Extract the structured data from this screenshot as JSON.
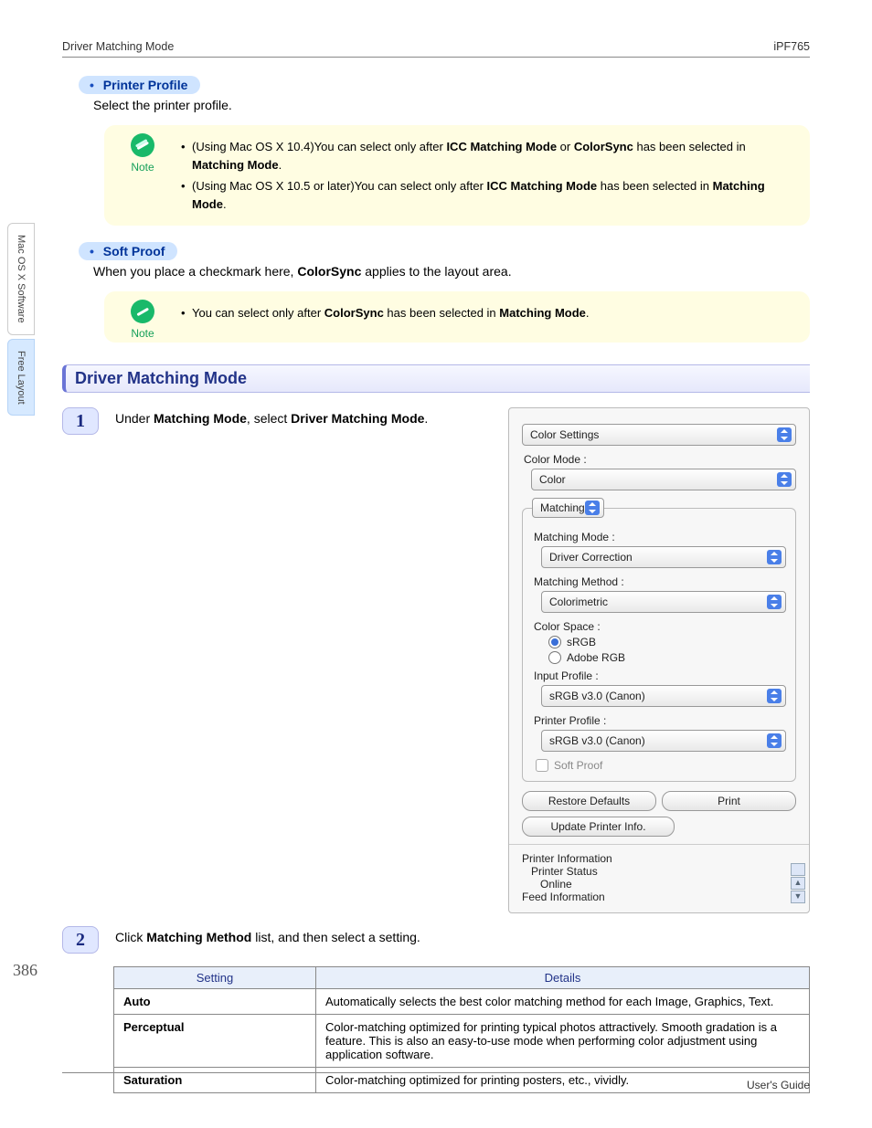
{
  "header": {
    "left": "Driver Matching Mode",
    "right": "iPF765"
  },
  "footer": {
    "text": "User's Guide"
  },
  "page_number": "386",
  "side_tabs": {
    "main": "Mac OS X Software",
    "sub": "Free Layout"
  },
  "sections": {
    "printer_profile": {
      "title": "Printer Profile",
      "desc": "Select the printer profile.",
      "note_label": "Note",
      "notes": [
        {
          "pre": "(Using Mac OS X 10.4)You can select only after ",
          "b1": "ICC Matching Mode",
          "mid1": " or ",
          "b2": "ColorSync",
          "mid2": " has been selected in ",
          "b3": "Matching Mode",
          "post": "."
        },
        {
          "pre": "(Using Mac OS X 10.5 or later)You can select only after ",
          "b1": "ICC Matching Mode",
          "mid1": " has been selected in ",
          "b2": "Matching Mode",
          "post": "."
        }
      ]
    },
    "soft_proof": {
      "title": "Soft Proof",
      "desc_pre": "When you place a checkmark here, ",
      "desc_b": "ColorSync",
      "desc_post": " applies to the layout area.",
      "note_label": "Note",
      "notes": [
        {
          "pre": "You can select only after ",
          "b1": "ColorSync",
          "mid1": " has been selected in ",
          "b2": "Matching Mode",
          "post": "."
        }
      ]
    }
  },
  "main_heading": "Driver Matching Mode",
  "steps": {
    "s1": {
      "num": "1",
      "pre": "Under ",
      "b1": "Matching Mode",
      "mid": ", select ",
      "b2": "Driver Matching Mode",
      "post": "."
    },
    "s2": {
      "num": "2",
      "pre": "Click ",
      "b1": "Matching Method",
      "post": " list, and then select a setting."
    }
  },
  "panel": {
    "top_select": "Color Settings",
    "color_mode_label": "Color Mode :",
    "color_mode_value": "Color",
    "matching_legend": "Matching",
    "matching_mode_label": "Matching Mode :",
    "matching_mode_value": "Driver Correction",
    "matching_method_label": "Matching Method :",
    "matching_method_value": "Colorimetric",
    "color_space_label": "Color Space :",
    "radio1": "sRGB",
    "radio2": "Adobe RGB",
    "input_profile_label": "Input Profile :",
    "input_profile_value": "sRGB v3.0 (Canon)",
    "printer_profile_label": "Printer Profile :",
    "printer_profile_value": "sRGB v3.0 (Canon)",
    "soft_proof": "Soft Proof",
    "restore": "Restore Defaults",
    "print": "Print",
    "update": "Update Printer Info.",
    "info1": "Printer Information",
    "info2": "Printer Status",
    "info3": "Online",
    "info4": "Feed Information"
  },
  "table": {
    "h1": "Setting",
    "h2": "Details",
    "rows": [
      {
        "k": "Auto",
        "v": "Automatically selects the best color matching method for each Image, Graphics, Text."
      },
      {
        "k": "Perceptual",
        "v": "Color-matching optimized for printing typical photos attractively. Smooth gradation is a feature. This is also an easy-to-use mode when performing color adjustment using application software."
      },
      {
        "k": "Saturation",
        "v": "Color-matching optimized for printing posters, etc., vividly."
      }
    ]
  }
}
